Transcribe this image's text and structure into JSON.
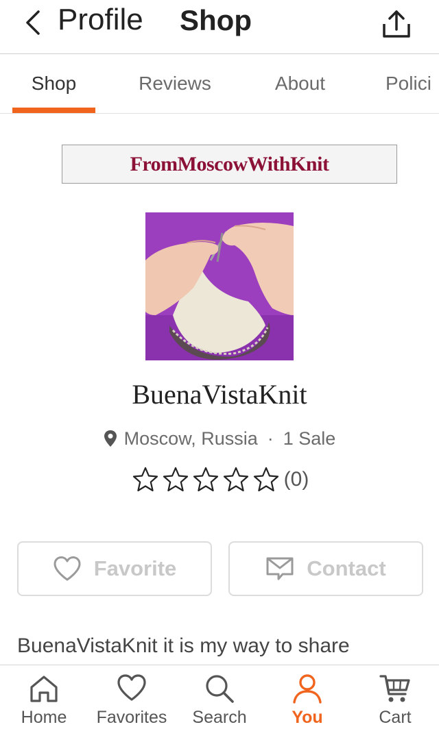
{
  "header": {
    "back_label": "Profile",
    "title": "Shop",
    "back_icon": "chevron-left-icon",
    "share_icon": "share-icon"
  },
  "tabs": [
    {
      "label": "Shop",
      "active": true
    },
    {
      "label": "Reviews",
      "active": false
    },
    {
      "label": "About",
      "active": false
    },
    {
      "label": "Polici",
      "active": false
    }
  ],
  "shop": {
    "banner_text": "FromMoscowWithKnit",
    "name": "BuenaVistaKnit",
    "location": "Moscow, Russia",
    "separator": "·",
    "sales": "1 Sale",
    "rating_stars": 0,
    "rating_max": 5,
    "review_count": "(0)",
    "description": "BuenaVistaKnit it is my way to share"
  },
  "actions": {
    "favorite_label": "Favorite",
    "contact_label": "Contact"
  },
  "bottom_nav": [
    {
      "label": "Home",
      "icon": "home-icon",
      "active": false
    },
    {
      "label": "Favorites",
      "icon": "heart-icon",
      "active": false
    },
    {
      "label": "Search",
      "icon": "search-icon",
      "active": false
    },
    {
      "label": "You",
      "icon": "user-icon",
      "active": true
    },
    {
      "label": "Cart",
      "icon": "cart-icon",
      "active": false
    }
  ],
  "colors": {
    "accent": "#f1641e",
    "banner_text": "#8c1137",
    "avatar_bg": "#9b3fbf"
  }
}
